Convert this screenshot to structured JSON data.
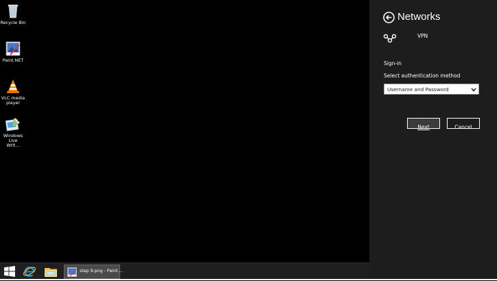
{
  "desktop": {
    "icons": [
      {
        "label": "Recycle Bin",
        "icon": "recycle-bin-icon"
      },
      {
        "label": "Paint.NET",
        "icon": "paint-net-icon"
      },
      {
        "label": "VLC media player",
        "icon": "vlc-icon"
      },
      {
        "label": "Windows Live Writ...",
        "icon": "windows-live-writer-icon"
      }
    ]
  },
  "taskbar": {
    "start_icon": "windows-logo-icon",
    "pinned": [
      {
        "name": "internet-explorer",
        "icon": "ie-icon"
      },
      {
        "name": "file-explorer",
        "icon": "folder-icon"
      }
    ],
    "active_task": {
      "label": "step 9.png - Paint....",
      "icon": "paint-net-icon"
    }
  },
  "charm": {
    "title": "Networks",
    "back_icon": "back-arrow-icon",
    "connection_icon": "vpn-connection-icon",
    "connection_name": "VPN",
    "section_heading": "Sign-in",
    "auth_label": "Select authentication method",
    "auth_selected": "Username and Password",
    "next_label": "Next",
    "cancel_label": "Cancel"
  },
  "colors": {
    "desktop_bg": "#000000",
    "charm_bg": "#1d1d1d",
    "taskbar_bg": "#1f1f1f",
    "select_bg": "#ffffff"
  }
}
